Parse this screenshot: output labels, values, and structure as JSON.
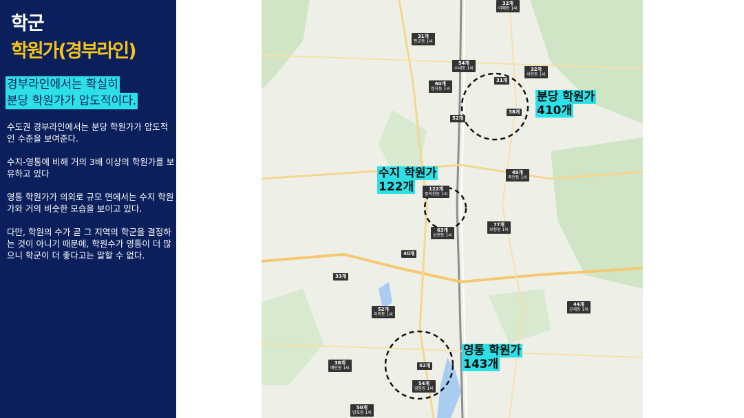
{
  "title": "학군",
  "subtitle": "학원가(경부라인)",
  "highlight": [
    "경부라인에서는 확실히",
    "분당 학원가가 압도적이다."
  ],
  "paragraphs": [
    "수도권 경부라인에서는 분당 학원가가 압도적인 수준을 보여준다.",
    "수지-영통에 비해 거의 3배 이상의 학원가를 보유하고 있다",
    "영통 학원가가 의외로 규모 면에서는 수지 학원가와 거의 비슷한 모습을 보이고 있다.",
    "다만, 학원의 수가 곧 그 지역의 학군을 결정하는 것이 아니기 때문에, 학원수가 영통이 더 많으니 학군이 더 좋다고는 말할 수 없다."
  ],
  "map": {
    "areas": [
      {
        "name": "분당 학원가",
        "count": "410개"
      },
      {
        "name": "수지 학원가",
        "count": "122개"
      },
      {
        "name": "영통 학원가",
        "count": "143개"
      }
    ],
    "markers": [
      {
        "count": "32개",
        "sub": "이매동 1씨"
      },
      {
        "count": "31개",
        "sub": "판교동 1씨"
      },
      {
        "count": "54개",
        "sub": "수내동 1씨"
      },
      {
        "count": "32개",
        "sub": "서현동 1씨"
      },
      {
        "count": "60개",
        "sub": "정자동 1씨"
      },
      {
        "count": "31개",
        "sub": ""
      },
      {
        "count": "38개",
        "sub": ""
      },
      {
        "count": "52개",
        "sub": ""
      },
      {
        "count": "49개",
        "sub": "죽전동 1씨"
      },
      {
        "count": "122개",
        "sub": "풍덕천동 1씨"
      },
      {
        "count": "77개",
        "sub": "보정동 1씨"
      },
      {
        "count": "63개",
        "sub": "상현동 1씨"
      },
      {
        "count": "40개",
        "sub": ""
      },
      {
        "count": "33개",
        "sub": ""
      },
      {
        "count": "52개",
        "sub": "이의동 1씨"
      },
      {
        "count": "44개",
        "sub": "공세동 1씨"
      },
      {
        "count": "38개",
        "sub": "매탄동 1씨"
      },
      {
        "count": "52개",
        "sub": ""
      },
      {
        "count": "54개",
        "sub": "영통동 1씨"
      },
      {
        "count": "50개",
        "sub": "망포동 1씨"
      }
    ]
  },
  "colors": {
    "sidebar": "#0b1f5c",
    "highlight": "#2de0e6",
    "subtitle": "#f5c518"
  }
}
